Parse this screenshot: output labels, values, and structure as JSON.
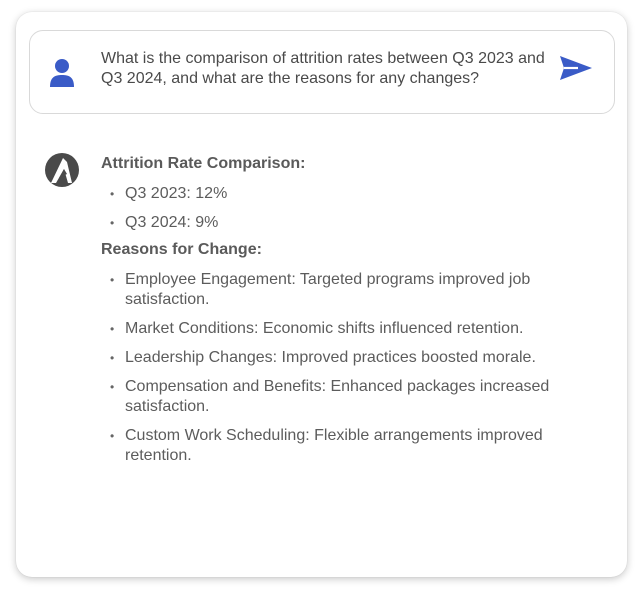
{
  "prompt": {
    "text": "What is the comparison of attrition rates between Q3 2023 and Q3 2024, and what are the reasons for any changes?"
  },
  "icons": {
    "user": "user-avatar-icon",
    "send": "send-icon",
    "bot": "assistant-logo-icon"
  },
  "colors": {
    "accent": "#3a5bc7",
    "bot_logo": "#4a4a4a"
  },
  "response": {
    "heading_1": "Attrition Rate Comparison:",
    "rates": [
      "Q3 2023: 12%",
      "Q3 2024: 9%"
    ],
    "heading_2": "Reasons for Change:",
    "reasons": [
      "Employee Engagement: Targeted programs improved job satisfaction.",
      "Market Conditions: Economic shifts influenced retention.",
      "Leadership Changes: Improved practices boosted morale.",
      "Compensation and Benefits: Enhanced packages increased satisfaction.",
      "Custom Work Scheduling: Flexible arrangements improved retention."
    ]
  }
}
